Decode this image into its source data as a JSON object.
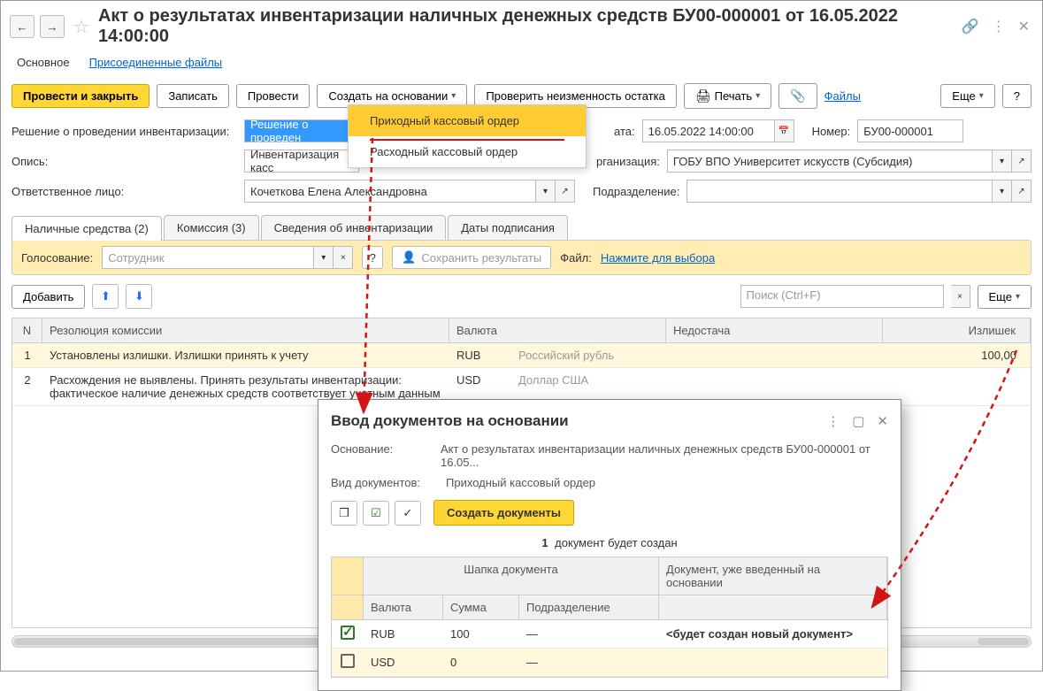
{
  "header": {
    "title": "Акт о результатах инвентаризации наличных денежных средств БУ00-000001 от 16.05.2022 14:00:00"
  },
  "mainTabs": {
    "t1": "Основное",
    "t2": "Присоединенные файлы"
  },
  "cmd": {
    "postClose": "Провести и закрыть",
    "save": "Записать",
    "post": "Провести",
    "createBased": "Создать на основании",
    "checkBalance": "Проверить неизменность остатка",
    "print": "Печать",
    "files": "Файлы",
    "more": "Еще",
    "help": "?"
  },
  "form": {
    "decisionLabel": "Решение о проведении инвентаризации:",
    "decisionValue": "Решение о проведен",
    "dateLabel": "ата:",
    "dateValue": "16.05.2022 14:00:00",
    "numberLabel": "Номер:",
    "numberValue": "БУ00-000001",
    "inventoryLabel": "Опись:",
    "inventoryValue": "Инвентаризация касс",
    "orgLabel": "рганизация:",
    "orgValue": "ГОБУ ВПО Университет искусств (Субсидия)",
    "respLabel": "Ответственное лицо:",
    "respValue": "Кочеткова Елена Александровна",
    "deptLabel": "Подразделение:",
    "deptValue": ""
  },
  "subtabs": {
    "t1": "Наличные средства (2)",
    "t2": "Комиссия (3)",
    "t3": "Сведения об инвентаризации",
    "t4": "Даты подписания"
  },
  "voteBar": {
    "label": "Голосование:",
    "placeholder": "Сотрудник",
    "saveResults": "Сохранить результаты",
    "fileLabel": "Файл:",
    "fileLink": "Нажмите для выбора"
  },
  "tableCtrl": {
    "add": "Добавить",
    "searchPlaceholder": "Поиск (Ctrl+F)",
    "more": "Еще"
  },
  "table": {
    "headers": {
      "n": "N",
      "res": "Резолюция комиссии",
      "cur": "Валюта",
      "short": "Недостача",
      "surplus": "Излишек"
    },
    "rows": [
      {
        "n": "1",
        "res": "Установлены излишки. Излишки принять к учету",
        "code": "RUB",
        "name": "Российский рубль",
        "short": "",
        "surplus": "100,00"
      },
      {
        "n": "2",
        "res": "Расхождения не выявлены. Принять результаты инвентаризации: фактическое наличие денежных средств соответствует учетным данным",
        "code": "USD",
        "name": "Доллар США",
        "short": "",
        "surplus": ""
      }
    ]
  },
  "dropdown": {
    "item1": "Приходный кассовый ордер",
    "item2": "Расходный кассовый ордер"
  },
  "dialog": {
    "title": "Ввод документов на основании",
    "basisLabel": "Основание:",
    "basisValue": "Акт о результатах инвентаризации наличных денежных средств БУ00-000001 от 16.05...",
    "docTypeLabel": "Вид документов:",
    "docTypeValue": "Приходный кассовый ордер",
    "createDocs": "Создать документы",
    "infoNum": "1",
    "infoText": "документ будет создан",
    "headers1": {
      "hdr1": "Шапка документа",
      "hdr2": "Документ, уже введенный на основании"
    },
    "headers2": {
      "cur": "Валюта",
      "sum": "Сумма",
      "dep": "Подразделение"
    },
    "rows": [
      {
        "checked": true,
        "cur": "RUB",
        "sum": "100",
        "dep": "—",
        "doc": "<будет создан новый документ>"
      },
      {
        "checked": false,
        "cur": "USD",
        "sum": "0",
        "dep": "—",
        "doc": ""
      }
    ]
  }
}
